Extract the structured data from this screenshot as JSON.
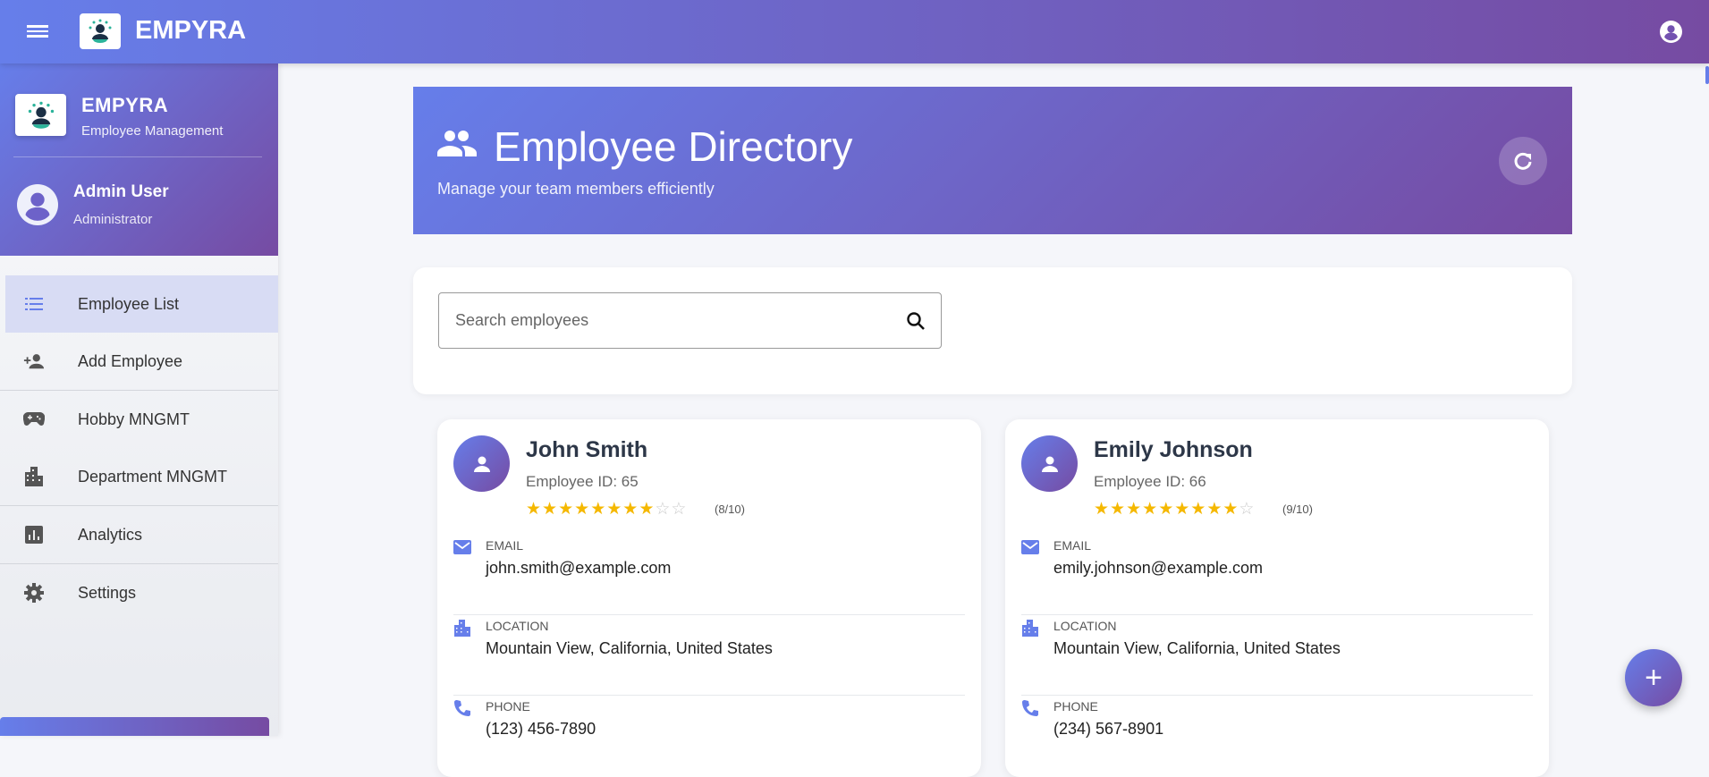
{
  "app": {
    "brand": "EMPYRA",
    "subtitle": "Employee Management"
  },
  "user": {
    "name": "Admin User",
    "role": "Administrator"
  },
  "nav": [
    {
      "label": "Employee List",
      "icon": "list-icon"
    },
    {
      "label": "Add Employee",
      "icon": "person-add-icon"
    },
    {
      "label": "Hobby MNGMT",
      "icon": "gamepad-icon"
    },
    {
      "label": "Department MNGMT",
      "icon": "building-icon"
    },
    {
      "label": "Analytics",
      "icon": "analytics-icon"
    },
    {
      "label": "Settings",
      "icon": "gear-icon"
    }
  ],
  "banner": {
    "title": "Employee Directory",
    "subtitle": "Manage your team members efficiently"
  },
  "search": {
    "placeholder": "Search employees",
    "value": ""
  },
  "labels": {
    "email": "EMAIL",
    "location": "LOCATION",
    "phone": "PHONE"
  },
  "employees": [
    {
      "name": "John Smith",
      "id_text": "Employee ID: 65",
      "rating": 8,
      "rating_text": "(8/10)",
      "email": "john.smith@example.com",
      "location": "Mountain View, California, United States",
      "phone": "(123) 456-7890"
    },
    {
      "name": "Emily Johnson",
      "id_text": "Employee ID: 66",
      "rating": 9,
      "rating_text": "(9/10)",
      "email": "emily.johnson@example.com",
      "location": "Mountain View, California, United States",
      "phone": "(234) 567-8901"
    }
  ],
  "fab": "+",
  "colors": {
    "accent": "#667eea",
    "accent2": "#764ba2",
    "star": "#f5b800"
  }
}
